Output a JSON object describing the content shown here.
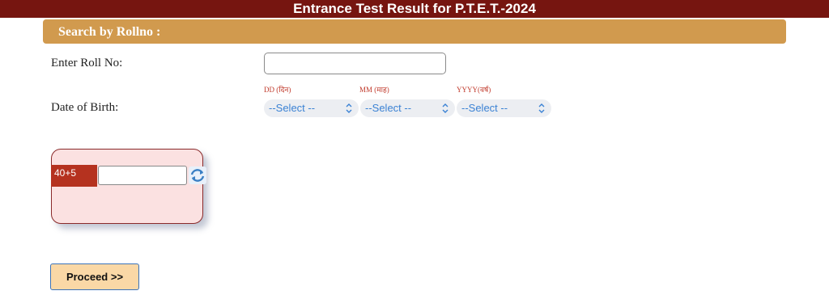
{
  "header": {
    "title": "Entrance Test Result for P.T.E.T.-2024"
  },
  "search": {
    "title": "Search by Rollno :"
  },
  "form": {
    "roll_label": "Enter Roll No:",
    "roll_value": "",
    "dob_label": "Date of Birth:",
    "hints": {
      "dd": "DD (दिन)",
      "mm": "MM (माह)",
      "yyyy": "YYYY(वर्ष)"
    },
    "selects": {
      "dd": "--Select --",
      "mm": "--Select --",
      "yyyy": "--Select --"
    }
  },
  "captcha": {
    "code": "40+5",
    "answer": ""
  },
  "actions": {
    "proceed_label": "Proceed >>"
  },
  "colors": {
    "header_bg": "#761510",
    "section_bg": "#d19a4e",
    "captcha_code_bg": "#b5321f",
    "proceed_bg": "#fad8a6"
  },
  "icons": {
    "select_arrow": "chevron-updown-icon",
    "refresh": "refresh-icon"
  }
}
